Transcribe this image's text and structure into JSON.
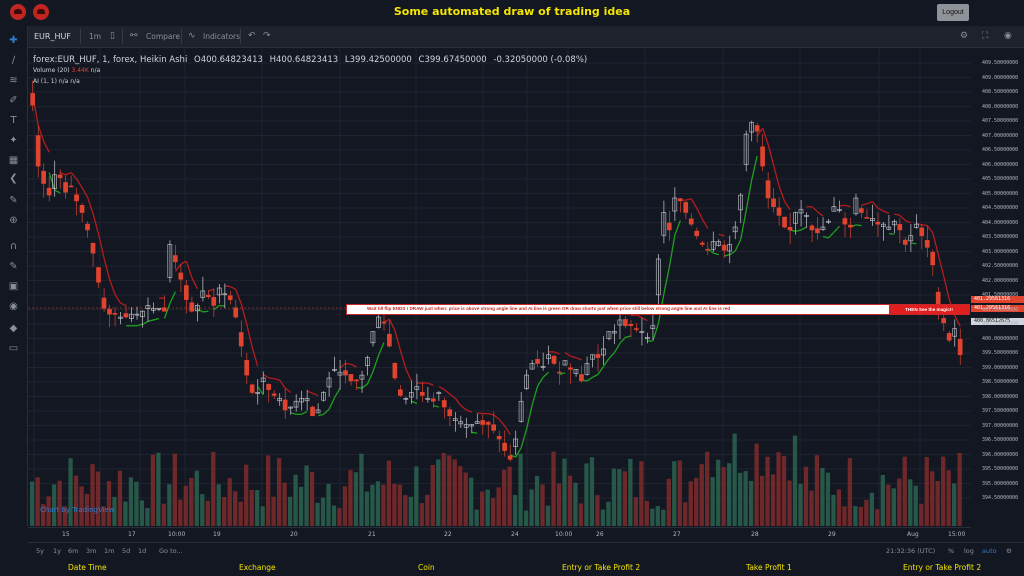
{
  "header": {
    "title": "Some automated draw of trading idea",
    "logout_label": "Logout"
  },
  "toolbar": {
    "symbol": "EUR_HUF",
    "interval": "1m",
    "compare_label": "Compare",
    "indicators_label": "Indicators"
  },
  "legend": {
    "title": "forex:EUR_HUF, 1, forex, Heikin Ashi",
    "open": "O400.64823413",
    "high": "H400.64823413",
    "low": "L399.42500000",
    "close": "C399.67450000",
    "change": "-0.32050000 (-0.08%)",
    "volume_label": "Volume (20)",
    "volume_value": "3.44K",
    "volume_na": "n/a",
    "ai_label": "AI (1, 1)",
    "ai_na1": "n/a",
    "ai_na2": "n/a"
  },
  "callout": {
    "text": "Wait till flip ENDS  !   DRAW just when:  price is above strong angle line and AI line is green        OR        draw shorts just when price still below strong angle line and AI line is red",
    "end_text": "THEN See the magic!!"
  },
  "price_tags": {
    "tag1": "401.29561316",
    "tag2": "401.29561316",
    "tag3": "400.86512675"
  },
  "y_axis": {
    "labels": [
      "409.50000000",
      "409.00000000",
      "408.50000000",
      "408.00000000",
      "407.50000000",
      "407.00000000",
      "406.50000000",
      "406.00000000",
      "405.50000000",
      "405.00000000",
      "404.50000000",
      "404.00000000",
      "403.50000000",
      "403.00000000",
      "402.50000000",
      "402.00000000",
      "401.50000000",
      "401.00000000",
      "400.50000000",
      "400.00000000",
      "399.50000000",
      "399.00000000",
      "398.50000000",
      "398.00000000",
      "397.50000000",
      "397.00000000",
      "396.50000000",
      "396.00000000",
      "395.50000000",
      "395.00000000",
      "394.50000000"
    ]
  },
  "x_axis": {
    "labels": [
      "15",
      "17",
      "10:00",
      "19",
      "20",
      "21",
      "22",
      "24",
      "10:00",
      "26",
      "27",
      "28",
      "29",
      "Aug",
      "15:00"
    ]
  },
  "bottombar": {
    "ranges": [
      "5y",
      "1y",
      "6m",
      "3m",
      "1m",
      "5d",
      "1d"
    ],
    "goto_label": "Go to...",
    "time": "21:32:36 (UTC)",
    "percent": "%",
    "log": "log",
    "auto": "auto"
  },
  "footer": {
    "items": [
      "Date Time",
      "Exchange",
      "Coin",
      "Entry or Take Profit 2",
      "Take Profit 1",
      "Entry or Take Profit 2"
    ]
  },
  "watermark": "Chart by TradingView",
  "colors": {
    "up": "#8fa39c",
    "down": "#e0442f",
    "ai_green": "#1ea01e",
    "ai_red": "#b71c1c",
    "accent": "#f5e600"
  },
  "chart_data": {
    "type": "candlestick",
    "title": "forex:EUR_HUF, 1, forex, Heikin Ashi",
    "ylim": [
      394.25,
      409.75
    ],
    "close_series": [
      408.3,
      406.2,
      405.6,
      405.2,
      405.9,
      405.8,
      405.3,
      405.5,
      405.0,
      404.6,
      404.0,
      403.2,
      402.2,
      401.3,
      401.1,
      401.1,
      401.0,
      401.0,
      401.1,
      401.1,
      401.2,
      401.4,
      401.3,
      401.3,
      401.2,
      403.5,
      402.9,
      402.3,
      401.6,
      401.2,
      401.4,
      401.9,
      401.7,
      401.4,
      402.0,
      401.8,
      401.6,
      401.0,
      400.0,
      399.0,
      398.4,
      398.4,
      398.9,
      398.5,
      398.3,
      398.2,
      397.8,
      397.9,
      398.1,
      398.2,
      398.2,
      397.6,
      397.8,
      398.4,
      398.9,
      399.2,
      399.1,
      399.0,
      398.8,
      398.8,
      399.0,
      399.6,
      400.5,
      401.0,
      400.8,
      400.0,
      398.9,
      398.3,
      398.2,
      398.4,
      398.6,
      398.3,
      398.2,
      398.1,
      398.4,
      397.9,
      397.6,
      397.5,
      397.4,
      397.3,
      397.3,
      397.4,
      397.3,
      397.3,
      397.1,
      396.8,
      396.4,
      396.1,
      396.8,
      398.1,
      399.0,
      399.4,
      399.4,
      399.3,
      399.7,
      399.4,
      399.1,
      399.5,
      399.2,
      399.2,
      398.8,
      399.4,
      399.7,
      399.6,
      399.9,
      400.5,
      400.5,
      400.9,
      400.7,
      400.7,
      400.6,
      400.5,
      400.3,
      400.7,
      403.0,
      404.6,
      404.0,
      405.1,
      405.0,
      404.6,
      404.2,
      403.8,
      403.5,
      403.3,
      403.6,
      403.6,
      403.3,
      403.5,
      404.1,
      405.2,
      407.3,
      407.7,
      407.4,
      406.2,
      405.1,
      404.8,
      404.5,
      404.1,
      404.0,
      404.6,
      404.7,
      404.5,
      404.0,
      403.9,
      404.1,
      404.3,
      404.8,
      404.7,
      404.2,
      404.1,
      405.1,
      404.6,
      404.4,
      404.4,
      404.2,
      404.2,
      404.1,
      404.3,
      404.0,
      403.5,
      403.8,
      404.2,
      403.8,
      403.4,
      402.8,
      401.2,
      400.8,
      400.2,
      400.6,
      399.7
    ]
  }
}
